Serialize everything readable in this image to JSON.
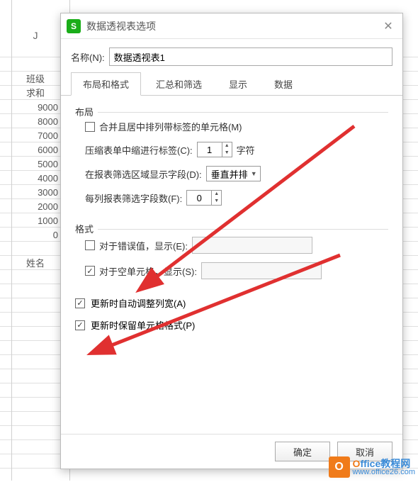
{
  "spreadsheet": {
    "col_header": "J",
    "cells": [
      "班级",
      "求和",
      "9000",
      "8000",
      "7000",
      "6000",
      "5000",
      "4000",
      "3000",
      "2000",
      "1000",
      "0",
      "",
      "姓名"
    ]
  },
  "dialog": {
    "app_icon": "S",
    "title": "数据透视表选项",
    "name_label": "名称(N):",
    "name_value": "数据透视表1",
    "tabs": {
      "layout": "布局和格式",
      "totals": "汇总和筛选",
      "display": "显示",
      "data": "数据"
    },
    "layout": {
      "legend": "布局",
      "merge_label": "合并且居中排列带标签的单元格(M)",
      "indent_label": "压缩表单中缩进行标签(C):",
      "indent_value": "1",
      "indent_unit": "字符",
      "filter_area_label": "在报表筛选区域显示字段(D):",
      "filter_area_value": "垂直并排",
      "fields_per_col_label": "每列报表筛选字段数(F):",
      "fields_per_col_value": "0"
    },
    "format": {
      "legend": "格式",
      "error_label": "对于错误值，显示(E):",
      "empty_label": "对于空单元格，显示(S):",
      "autofit_label": "更新时自动调整列宽(A)",
      "preserve_label": "更新时保留单元格格式(P)"
    },
    "buttons": {
      "ok": "确定",
      "cancel": "取消"
    }
  },
  "watermark": {
    "brand_o": "O",
    "brand_rest": "ffice教程网",
    "url": "www.office26.com"
  }
}
